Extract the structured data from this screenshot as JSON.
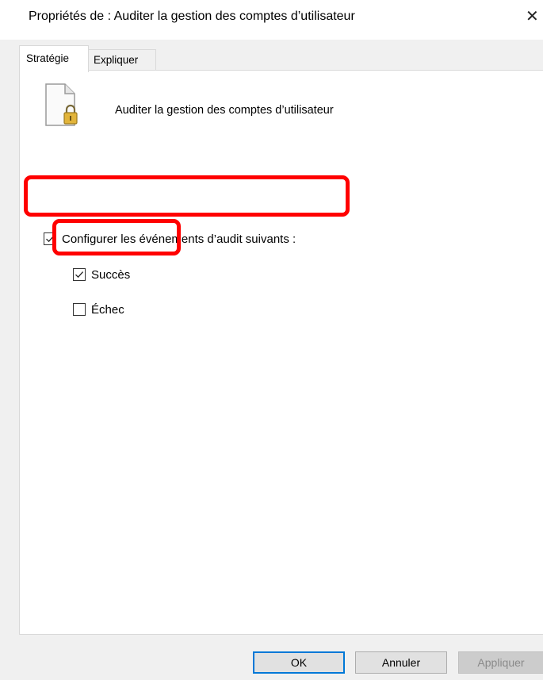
{
  "window": {
    "title": "Propriétés de : Auditer la gestion des comptes d’utilisateur",
    "close_glyph": "✕"
  },
  "tabs": [
    {
      "label": "Stratégie",
      "active": true
    },
    {
      "label": "Expliquer",
      "active": false
    }
  ],
  "policy": {
    "icon": "policy-document-lock-icon",
    "name": "Auditer la gestion des comptes d’utilisateur"
  },
  "options": {
    "configure": {
      "label": "Configurer les événements d’audit suivants :",
      "checked": true
    },
    "success": {
      "label": "Succès",
      "checked": true
    },
    "failure": {
      "label": "Échec",
      "checked": false
    }
  },
  "buttons": {
    "ok": "OK",
    "cancel": "Annuler",
    "apply": {
      "label": "Appliquer",
      "disabled": true
    }
  },
  "colors": {
    "highlight": "#ff0000",
    "default_button_border": "#0078d7",
    "panel_background": "#f0f0f0"
  }
}
